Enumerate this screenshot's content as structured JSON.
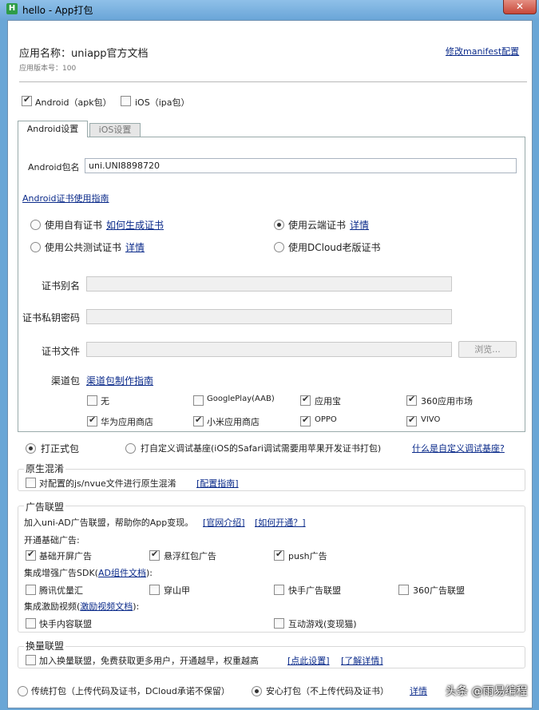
{
  "window": {
    "title": "hello - App打包",
    "close": "✕",
    "app_icon_letter": "H"
  },
  "header": {
    "app_name": "应用名称：uniapp官方文档",
    "version": "应用版本号：100",
    "manifest_link": "修改manifest配置"
  },
  "platforms": {
    "android": "Android（apk包）",
    "ios": "iOS（ipa包）"
  },
  "tabs": {
    "android": "Android设置",
    "ios": "iOS设置"
  },
  "android": {
    "package_label": "Android包名",
    "package_value": "uni.UNI8898720",
    "cert_guide": "Android证书使用指南",
    "opt_own": "使用自有证书",
    "opt_own_link": "如何生成证书",
    "opt_cloud": "使用云端证书",
    "opt_cloud_link": "详情",
    "opt_public": "使用公共测试证书",
    "opt_public_link": "详情",
    "opt_old": "使用DCloud老版证书",
    "alias_label": "证书别名",
    "password_label": "证书私钥密码",
    "file_label": "证书文件",
    "browse": "浏览...",
    "channel_label": "渠道包",
    "channel_link": "渠道包制作指南",
    "channels": {
      "none": "无",
      "googleplay": "GooglePlay(AAB)",
      "yyb": "应用宝",
      "m360": "360应用市场",
      "huawei": "华为应用商店",
      "xiaomi": "小米应用商店",
      "oppo": "OPPO",
      "vivo": "VIVO"
    }
  },
  "build_type": {
    "formal": "打正式包",
    "custom": "打自定义调试基座(iOS的Safari调试需要用苹果开发证书打包)",
    "custom_link": "什么是自定义调试基座?"
  },
  "obfuscation": {
    "title": "原生混淆",
    "option": "对配置的js/nvue文件进行原生混淆",
    "link": "[配置指南]"
  },
  "ads": {
    "title": "广告联盟",
    "intro": "加入uni-AD广告联盟，帮助你的App变现。",
    "intro_link1": "[官网介绍]",
    "intro_link2": "[如何开通？]",
    "basic_title": "开通基础广告:",
    "splash": "基础开屏广告",
    "redpacket": "悬浮红包广告",
    "push": "push广告",
    "sdk_title_a": "集成增强广告SDK(",
    "sdk_title_link": "AD组件文档",
    "sdk_title_b": "):",
    "tencent": "腾讯优量汇",
    "pangle": "穿山甲",
    "kuaishou": "快手广告联盟",
    "m360": "360广告联盟",
    "video_title_a": "集成激励视频(",
    "video_title_link": "激励视频文档",
    "video_title_b": "):",
    "ks_content": "快手内容联盟",
    "game": "互动游戏(变现猫)"
  },
  "exchange": {
    "title": "换量联盟",
    "option": "加入换量联盟，免费获取更多用户，开通越早，权重越高",
    "link1": "[点此设置]",
    "link2": "[了解详情]"
  },
  "packaging": {
    "traditional": "传统打包（上传代码及证书，DCloud承诺不保留）",
    "safe": "安心打包（不上传代码及证书）",
    "detail": "详情"
  },
  "watermark": "头条 @雨易编程"
}
